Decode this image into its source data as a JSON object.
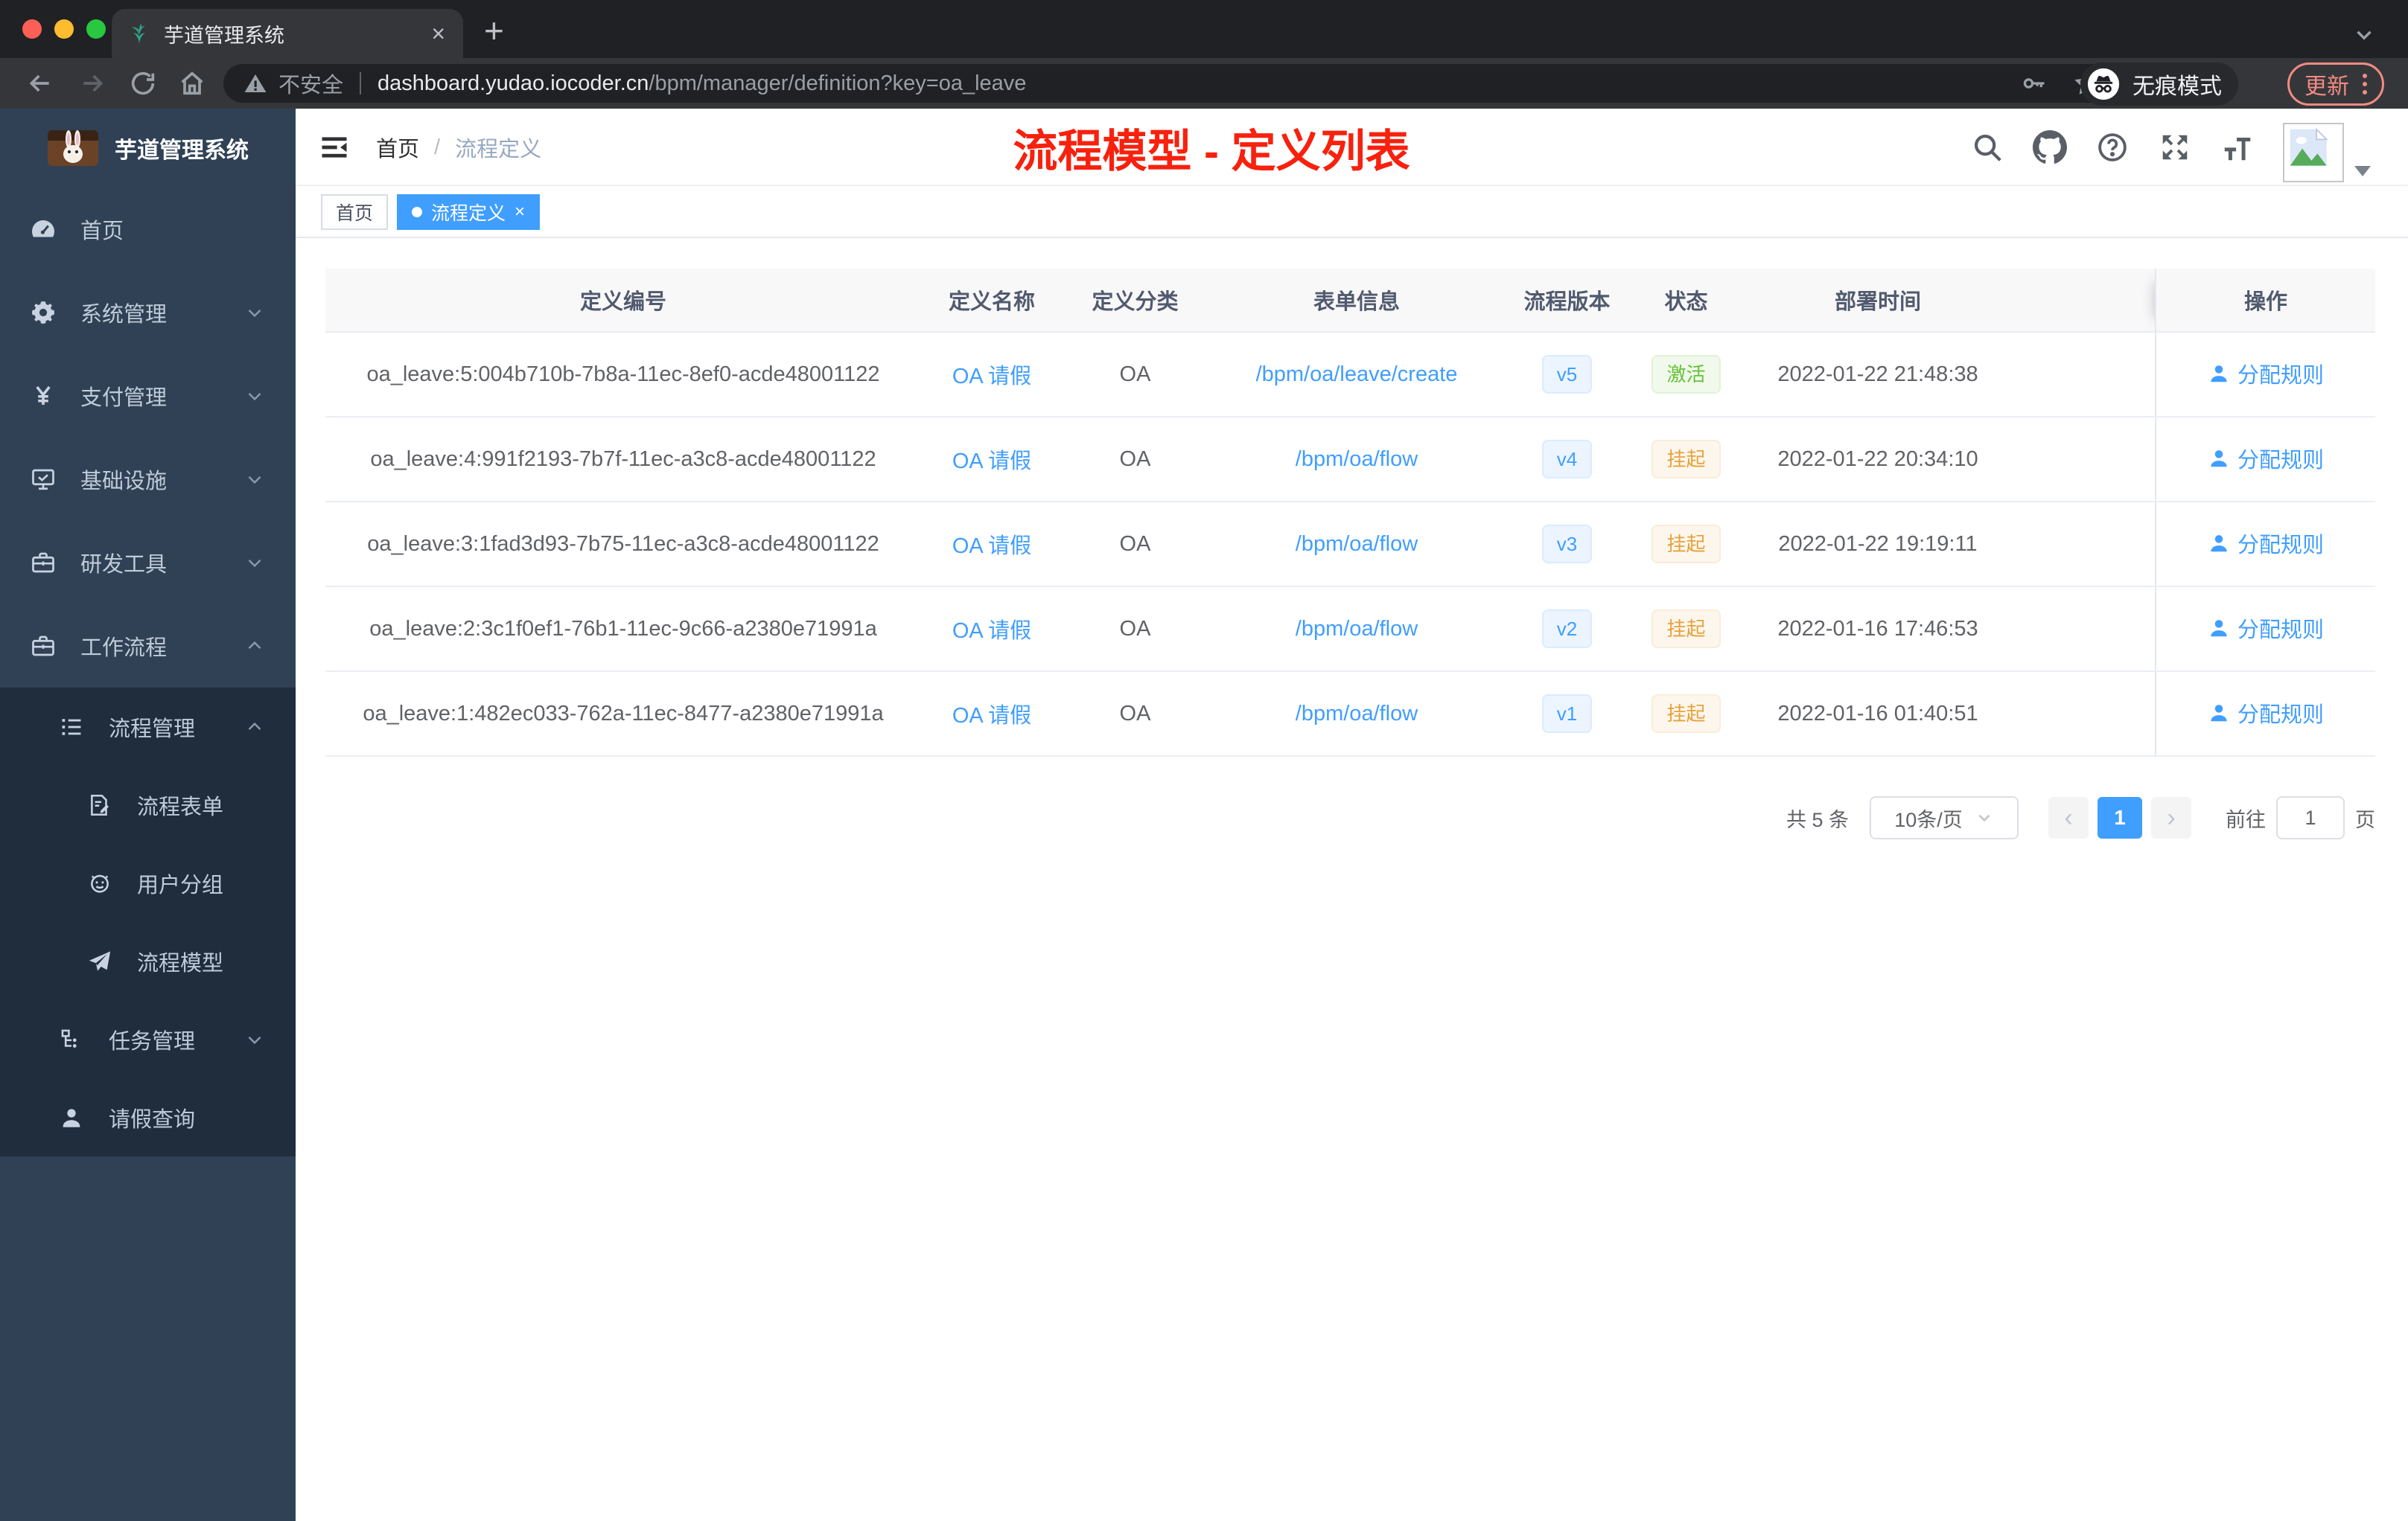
{
  "browser": {
    "tab": {
      "title": "芋道管理系统",
      "close": "×",
      "new_tab": "+"
    },
    "address": {
      "security": "不安全",
      "host": "dashboard.yudao.iocoder.cn",
      "path": "/bpm/manager/definition?key=oa_leave"
    },
    "incognito_label": "无痕模式",
    "update_label": "更新"
  },
  "sidebar": {
    "title": "芋道管理系统",
    "items": [
      {
        "label": "首页",
        "icon": "dashboard-icon",
        "level": 0
      },
      {
        "label": "系统管理",
        "icon": "gear-icon",
        "level": 0,
        "chevron": "down"
      },
      {
        "label": "支付管理",
        "icon": "yen-icon",
        "level": 0,
        "chevron": "down"
      },
      {
        "label": "基础设施",
        "icon": "monitor-icon",
        "level": 0,
        "chevron": "down"
      },
      {
        "label": "研发工具",
        "icon": "toolbox-icon",
        "level": 0,
        "chevron": "down"
      },
      {
        "label": "工作流程",
        "icon": "briefcase-icon",
        "level": 0,
        "chevron": "up"
      },
      {
        "label": "流程管理",
        "icon": "list-icon",
        "level": 1,
        "chevron": "up",
        "dark": true
      },
      {
        "label": "流程表单",
        "icon": "form-icon",
        "level": 2,
        "dark": true
      },
      {
        "label": "用户分组",
        "icon": "robot-icon",
        "level": 2,
        "dark": true
      },
      {
        "label": "流程模型",
        "icon": "send-icon",
        "level": 2,
        "dark": true
      },
      {
        "label": "任务管理",
        "icon": "tree-icon",
        "level": 1,
        "chevron": "down",
        "dark": true
      },
      {
        "label": "请假查询",
        "icon": "user-icon",
        "level": 1,
        "dark": true
      }
    ]
  },
  "navbar": {
    "breadcrumb": [
      "首页",
      "流程定义"
    ],
    "separator": "/",
    "annotation": "流程模型 - 定义列表"
  },
  "tag_close": "×",
  "tags": [
    {
      "label": "首页",
      "active": false
    },
    {
      "label": "流程定义",
      "active": true
    }
  ],
  "table": {
    "columns": [
      "定义编号",
      "定义名称",
      "定义分类",
      "表单信息",
      "流程版本",
      "状态",
      "部署时间",
      "操作"
    ],
    "rows": [
      {
        "id": "oa_leave:5:004b710b-7b8a-11ec-8ef0-acde48001122",
        "name": "OA 请假",
        "category": "OA",
        "form": "/bpm/oa/leave/create",
        "version": "v5",
        "status": "激活",
        "status_color": "green",
        "deploy_time": "2022-01-22 21:48:38",
        "action": "分配规则"
      },
      {
        "id": "oa_leave:4:991f2193-7b7f-11ec-a3c8-acde48001122",
        "name": "OA 请假",
        "category": "OA",
        "form": "/bpm/oa/flow",
        "version": "v4",
        "status": "挂起",
        "status_color": "yellow",
        "deploy_time": "2022-01-22 20:34:10",
        "action": "分配规则"
      },
      {
        "id": "oa_leave:3:1fad3d93-7b75-11ec-a3c8-acde48001122",
        "name": "OA 请假",
        "category": "OA",
        "form": "/bpm/oa/flow",
        "version": "v3",
        "status": "挂起",
        "status_color": "yellow",
        "deploy_time": "2022-01-22 19:19:11",
        "action": "分配规则"
      },
      {
        "id": "oa_leave:2:3c1f0ef1-76b1-11ec-9c66-a2380e71991a",
        "name": "OA 请假",
        "category": "OA",
        "form": "/bpm/oa/flow",
        "version": "v2",
        "status": "挂起",
        "status_color": "yellow",
        "deploy_time": "2022-01-16 17:46:53",
        "action": "分配规则"
      },
      {
        "id": "oa_leave:1:482ec033-762a-11ec-8477-a2380e71991a",
        "name": "OA 请假",
        "category": "OA",
        "form": "/bpm/oa/flow",
        "version": "v1",
        "status": "挂起",
        "status_color": "yellow",
        "deploy_time": "2022-01-16 01:40:51",
        "action": "分配规则"
      }
    ]
  },
  "pagination": {
    "total": "共 5 条",
    "page_size": "10条/页",
    "prev": "‹",
    "next": "›",
    "active_page": "1",
    "goto_label": "前往",
    "goto_value": "1",
    "goto_unit": "页"
  },
  "colors": {
    "accent": "#409eff",
    "sidebar_bg": "#304156",
    "submenu_bg": "#1f2d3d",
    "annotation_red": "#f7210e",
    "status_active_green": "#67c23a",
    "status_suspend_yellow": "#e6a23c"
  }
}
